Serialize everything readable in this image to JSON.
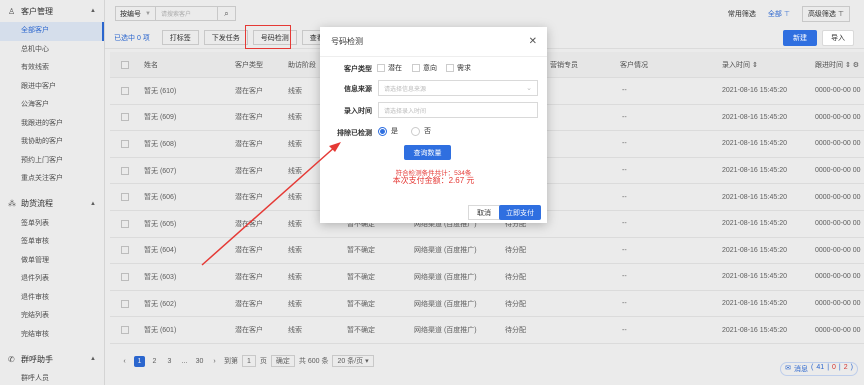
{
  "sidebar": {
    "groups": [
      {
        "label": "客户管理",
        "icon": "user-icon",
        "items": [
          "全部客户",
          "总机中心",
          "有效线索",
          "跟进中客户",
          "公海客户",
          "我跟进的客户",
          "我协助的客户",
          "预约上门客户",
          "重点关注客户"
        ]
      },
      {
        "label": "助货流程",
        "icon": "flow-icon",
        "items": [
          "签单列表",
          "签单审核",
          "做单管理",
          "退件列表",
          "退件审核",
          "完结列表",
          "完结审核"
        ]
      },
      {
        "label": "群呼助手",
        "icon": "phone-icon",
        "items": [
          "群呼人员"
        ]
      }
    ],
    "active_item": "全部客户"
  },
  "filter": {
    "field_select": "按编号",
    "input_placeholder": "请搜索客户",
    "common_filter": "常用筛选",
    "all": "全部",
    "advanced": "高级筛选"
  },
  "toolbar": {
    "selected": "已选中 0 项",
    "buttons": [
      "打标签",
      "下发任务",
      "号码检测",
      "查看线索"
    ],
    "new": "新建",
    "import": "导入"
  },
  "table": {
    "headers": {
      "name": "姓名",
      "type": "客户类型",
      "stage": "助访阶段",
      "sales": "营销专员",
      "status": "客户情况",
      "entry": "录入时间 ⇕",
      "followup": "跟进时间 ⇕"
    },
    "rows": [
      {
        "name": "暂无 (610)",
        "type": "潜在客户",
        "stage": "线索",
        "intent": "",
        "channel": "",
        "assign": "",
        "status": "--",
        "entry": "2021-08-16 15:45:20",
        "followup": "0000-00-00 00"
      },
      {
        "name": "暂无 (609)",
        "type": "潜在客户",
        "stage": "线索",
        "intent": "",
        "channel": "",
        "assign": "",
        "status": "--",
        "entry": "2021-08-16 15:45:20",
        "followup": "0000-00-00 00"
      },
      {
        "name": "暂无 (608)",
        "type": "潜在客户",
        "stage": "线索",
        "intent": "",
        "channel": "",
        "assign": "",
        "status": "--",
        "entry": "2021-08-16 15:45:20",
        "followup": "0000-00-00 00"
      },
      {
        "name": "暂无 (607)",
        "type": "潜在客户",
        "stage": "线索",
        "intent": "",
        "channel": "",
        "assign": "",
        "status": "--",
        "entry": "2021-08-16 15:45:20",
        "followup": "0000-00-00 00"
      },
      {
        "name": "暂无 (606)",
        "type": "潜在客户",
        "stage": "线索",
        "intent": "",
        "channel": "",
        "assign": "",
        "status": "--",
        "entry": "2021-08-16 15:45:20",
        "followup": "0000-00-00 00"
      },
      {
        "name": "暂无 (605)",
        "type": "潜在客户",
        "stage": "线索",
        "intent": "暂不确定",
        "channel": "网络渠道 (百度推广)",
        "assign": "待分配",
        "status": "--",
        "entry": "2021-08-16 15:45:20",
        "followup": "0000-00-00 00"
      },
      {
        "name": "暂无 (604)",
        "type": "潜在客户",
        "stage": "线索",
        "intent": "暂不确定",
        "channel": "网络渠道 (百度推广)",
        "assign": "待分配",
        "status": "--",
        "entry": "2021-08-16 15:45:20",
        "followup": "0000-00-00 00"
      },
      {
        "name": "暂无 (603)",
        "type": "潜在客户",
        "stage": "线索",
        "intent": "暂不确定",
        "channel": "网络渠道 (百度推广)",
        "assign": "待分配",
        "status": "--",
        "entry": "2021-08-16 15:45:20",
        "followup": "0000-00-00 00"
      },
      {
        "name": "暂无 (602)",
        "type": "潜在客户",
        "stage": "线索",
        "intent": "暂不确定",
        "channel": "网络渠道 (百度推广)",
        "assign": "待分配",
        "status": "--",
        "entry": "2021-08-16 15:45:20",
        "followup": "0000-00-00 00"
      },
      {
        "name": "暂无 (601)",
        "type": "潜在客户",
        "stage": "线索",
        "intent": "暂不确定",
        "channel": "网络渠道 (百度推广)",
        "assign": "待分配",
        "status": "--",
        "entry": "2021-08-16 15:45:20",
        "followup": "0000-00-00 00"
      }
    ]
  },
  "pager": {
    "pages": [
      "1",
      "2",
      "3",
      "...",
      "30"
    ],
    "goto_label": "到第",
    "goto_value": "1",
    "page_unit": "页",
    "confirm": "确定",
    "total": "共 600 条",
    "per_page": "20 条/页"
  },
  "messages": {
    "label": "消息",
    "a": "41",
    "b": "0",
    "c": "2"
  },
  "modal": {
    "title": "号码检测",
    "customer_type_label": "客户类型",
    "type_options": [
      "潜在",
      "意向",
      "需求"
    ],
    "source_label": "信息来源",
    "source_placeholder": "请选择信息来源",
    "entry_label": "录入时间",
    "entry_placeholder": "请选择录入时间",
    "exclude_label": "排除已检测",
    "yes": "是",
    "no": "否",
    "query_button": "查询数量",
    "result_count": "符合检测条件共计：534条",
    "payment": "本次支付金额：2.67 元",
    "cancel": "取消",
    "pay": "立即支付"
  },
  "accent_color": "#2f6fe0",
  "highlight_color": "#e53935"
}
